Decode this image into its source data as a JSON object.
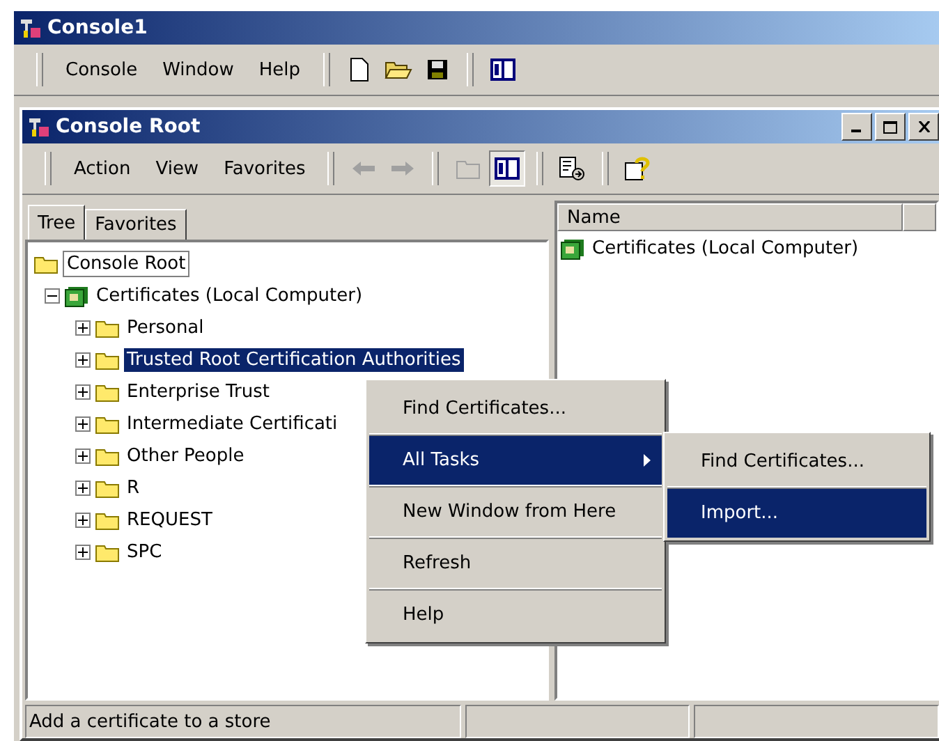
{
  "app_window": {
    "title": "Console1"
  },
  "menu_bar": [
    "Console",
    "Window",
    "Help"
  ],
  "console_window": {
    "title": "Console Root"
  },
  "action_menu": [
    "Action",
    "View",
    "Favorites"
  ],
  "toolbar_buttons": [
    {
      "kind": "back",
      "disabled": true,
      "pressed": false
    },
    {
      "kind": "forward",
      "disabled": true,
      "pressed": false
    },
    {
      "kind": "up",
      "disabled": true,
      "pressed": false
    },
    {
      "kind": "tree",
      "disabled": false,
      "pressed": true
    },
    {
      "kind": "export",
      "disabled": false,
      "pressed": false
    },
    {
      "kind": "help",
      "disabled": false,
      "pressed": false
    }
  ],
  "tabs": [
    {
      "label": "Tree",
      "selected": true
    },
    {
      "label": "Favorites",
      "selected": false
    }
  ],
  "tree": [
    {
      "label": "Console Root",
      "kind": "folder",
      "selected": false,
      "children": [
        {
          "label": "Certificates (Local Computer)",
          "kind": "snapin",
          "selected": false,
          "expanded": true,
          "children": [
            {
              "label": "Personal",
              "kind": "folder",
              "selected": false,
              "expanded": false
            },
            {
              "label": "Trusted Root Certification Authorities",
              "kind": "folder",
              "selected": true,
              "expanded": false
            },
            {
              "label": "Enterprise Trust",
              "kind": "folder",
              "selected": false,
              "expanded": false
            },
            {
              "label": "Intermediate Certificati",
              "kind": "folder",
              "selected": false,
              "expanded": false
            },
            {
              "label": "Other People",
              "kind": "folder",
              "selected": false,
              "expanded": false
            },
            {
              "label": "R",
              "kind": "folder",
              "selected": false,
              "expanded": false
            },
            {
              "label": "REQUEST",
              "kind": "folder",
              "selected": false,
              "expanded": false
            },
            {
              "label": "SPC",
              "kind": "folder",
              "selected": false,
              "expanded": false
            }
          ]
        }
      ]
    }
  ],
  "list": {
    "columns": [
      "Name"
    ],
    "rows": [
      "Certificates (Local Computer)"
    ]
  },
  "context_menu": [
    {
      "label": "Find Certificates...",
      "selected": false,
      "has_submenu": false
    },
    {
      "label": "All Tasks",
      "selected": true,
      "has_submenu": true
    },
    {
      "label": "New Window from Here",
      "selected": false,
      "has_submenu": false
    },
    {
      "label": "Refresh",
      "selected": false,
      "has_submenu": false
    },
    {
      "label": "Help",
      "selected": false,
      "has_submenu": false
    }
  ],
  "submenu": [
    {
      "label": "Find Certificates...",
      "selected": false
    },
    {
      "label": "Import...",
      "selected": true
    }
  ],
  "status_bar": [
    "Add a certificate to a store"
  ]
}
